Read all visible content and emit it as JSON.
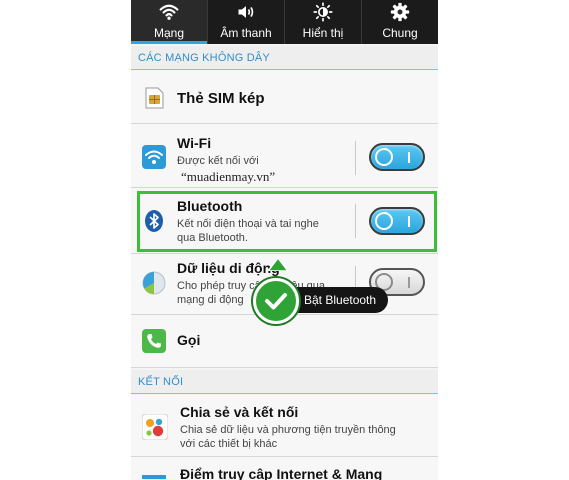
{
  "tabs": [
    {
      "label": "Mạng",
      "icon": "wifi-icon",
      "active": true
    },
    {
      "label": "Âm thanh",
      "icon": "speaker-icon",
      "active": false
    },
    {
      "label": "Hiển thị",
      "icon": "brightness-icon",
      "active": false
    },
    {
      "label": "Chung",
      "icon": "gear-icon",
      "active": false
    }
  ],
  "sections": {
    "wireless": "CÁC MẠNG KHÔNG DÂY",
    "connect": "KẾT NỐI"
  },
  "rows": {
    "dual_sim": {
      "title": "Thẻ SIM kép",
      "icon": "sim-card-icon"
    },
    "wifi": {
      "title": "Wi-Fi",
      "subtitle": "Được kết nối với",
      "toggle": "on",
      "icon": "wifi-icon"
    },
    "bluetooth": {
      "title": "Bluetooth",
      "subtitle_line1": "Kết nối điện thoại và tai nghe",
      "subtitle_line2": "qua Bluetooth.",
      "toggle": "on",
      "icon": "bluetooth-icon"
    },
    "mobile_data": {
      "title": "Dữ liệu di động",
      "subtitle_line1": "Cho phép truy cập dữ liệu qua",
      "subtitle_line2": "mạng di động",
      "toggle": "off",
      "icon": "data-usage-icon"
    },
    "call": {
      "title": "Gọi",
      "icon": "phone-icon"
    },
    "share": {
      "title": "Chia sẻ và kết nối",
      "subtitle_line1": "Chia sẻ dữ liệu và phương tiện truyền thông",
      "subtitle_line2": "với các thiết bị khác",
      "icon": "share-icon"
    },
    "hotspot": {
      "title": "Điểm truy cập Internet & Mạng"
    }
  },
  "annotation": {
    "watermark": "“muadienmay.vn”",
    "tooltip": "Bật Bluetooth"
  },
  "colors": {
    "accent": "#2fa6e0",
    "highlight": "#3cbe36",
    "check": "#2fa335"
  }
}
